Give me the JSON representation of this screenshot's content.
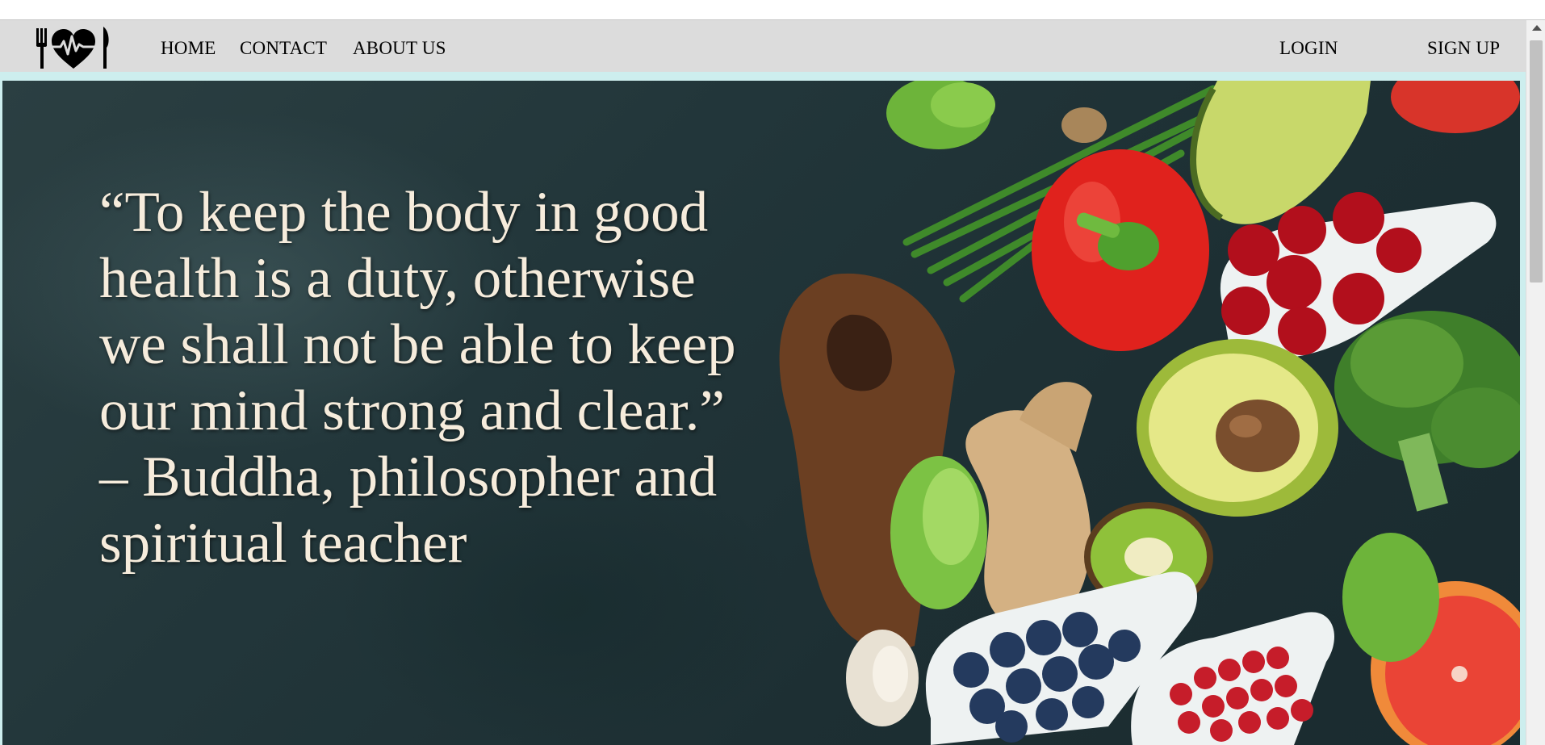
{
  "nav": {
    "logo_icon": "fork-heart-knife-icon",
    "home": "HOME",
    "contact": "CONTACT",
    "about": "ABOUT US",
    "login": "LOGIN",
    "signup": "SIGN UP"
  },
  "hero": {
    "quote": "“To keep the body in good health is a duty, otherwise we shall not be able to keep our mind strong and clear.” – Buddha, philosopher and spiritual teacher",
    "background_image": "healthy-food-vegetables-fruits-photo"
  },
  "colors": {
    "navbar_bg": "#dcdcdc",
    "quote_text": "#f6ecdc",
    "hero_bg": "#22363a",
    "frame_accent": "#cdeeee"
  }
}
